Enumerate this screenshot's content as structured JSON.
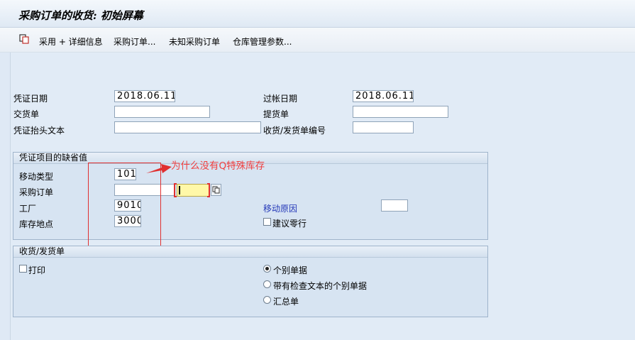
{
  "title": "采购订单的收货: 初始屏幕",
  "toolbar": {
    "icon": "copy-icon",
    "items": [
      "采用 + 详细信息",
      "采购订单...",
      "未知采购订单",
      "仓库管理参数..."
    ]
  },
  "header": {
    "doc_date_label": "凭证日期",
    "doc_date_value": "2018.06.11",
    "posting_date_label": "过帐日期",
    "posting_date_value": "2018.06.11",
    "delivery_note_label": "交货单",
    "delivery_note_value": "",
    "bill_of_lading_label": "提货单",
    "bill_of_lading_value": "",
    "header_text_label": "凭证抬头文本",
    "header_text_value": "",
    "gr_slip_label": "收货/发货单编号",
    "gr_slip_value": ""
  },
  "defaults": {
    "title": "凭证项目的缺省值",
    "movement_type_label": "移动类型",
    "movement_type_value": "101",
    "po_label": "采购订单",
    "po_value": "",
    "special_stock_value": "",
    "plant_label": "工厂",
    "plant_value": "9010",
    "storage_loc_label": "库存地点",
    "storage_loc_value": "3000",
    "reason_label": "移动原因",
    "reason_value": "",
    "suggest_zero_label": "建议零行",
    "suggest_zero_checked": false
  },
  "gr_slip": {
    "title": "收货/发货单",
    "print_label": "打印",
    "print_checked": false,
    "options": [
      "个别单据",
      "带有检查文本的个别单据",
      "汇总单"
    ],
    "selected_index": 0
  },
  "annotation": {
    "text": "为什么没有Q特殊库存",
    "color": "#e03030"
  }
}
